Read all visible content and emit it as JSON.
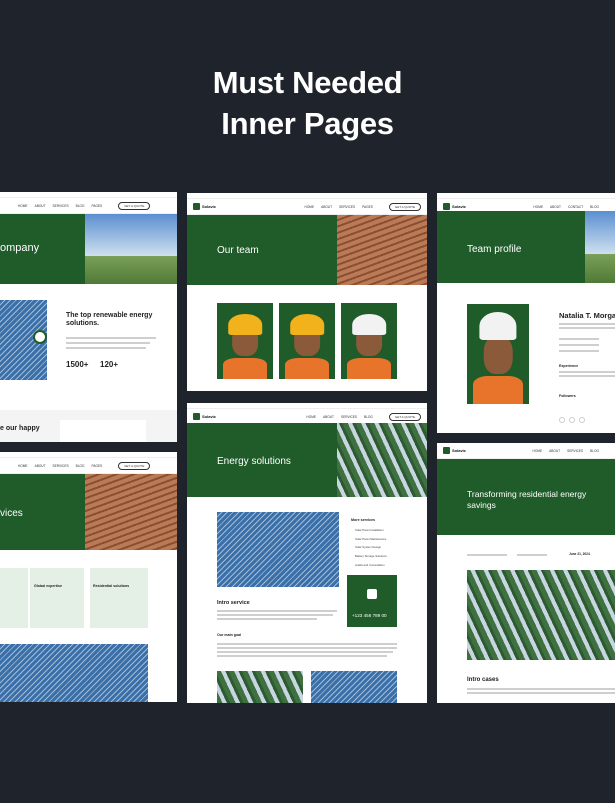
{
  "headline": {
    "line1": "Must Needed",
    "line2": "Inner Pages"
  },
  "pages": {
    "about": {
      "hero_title": "ompany",
      "heading": "The top renewable energy solutions.",
      "stat1": "1500+",
      "stat2": "120+",
      "bottom_heading": "e our happy"
    },
    "team": {
      "hero_title": "Our team",
      "logo": "Solavic",
      "button": "GET A QUOTE"
    },
    "profile": {
      "hero_title": "Team profile",
      "name": "Natalia T. Morgan",
      "section1": "Experience",
      "section2": "Followers"
    },
    "services": {
      "hero_title": "vices",
      "card1": "Global expertise",
      "card2": "Residential solutions"
    },
    "energy": {
      "hero_title": "Energy solutions",
      "sidebar_title": "More services",
      "services": [
        "Solar Panel Installation",
        "Solar Panel Maintenance",
        "Solar System Design",
        "Battery Storage Solutions",
        "Audits and Consultation"
      ],
      "section_title": "Intro service",
      "section_sub": "Our main goal",
      "phone": "+123 456 789 00",
      "logo": "Solavic"
    },
    "case": {
      "hero_title": "Transforming residential energy savings",
      "section_title": "Intro cases",
      "meta1": "June 21, 2024"
    }
  }
}
